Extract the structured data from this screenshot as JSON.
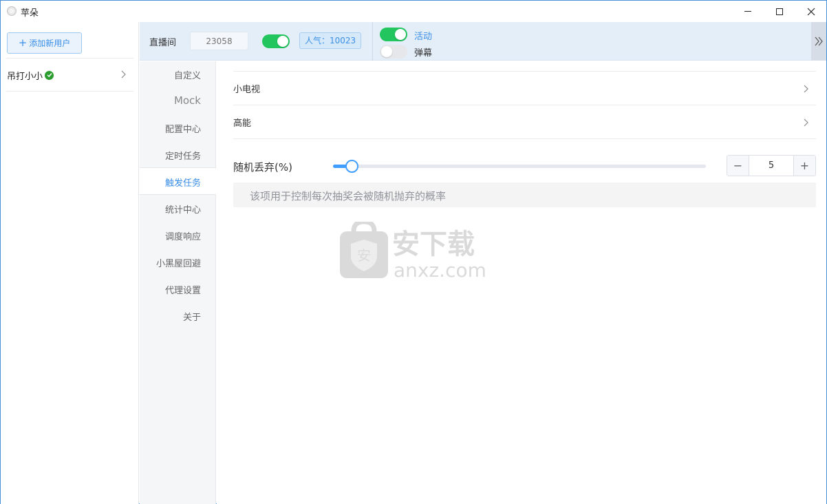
{
  "window": {
    "title": "苹朵",
    "controls": [
      "minimize",
      "maximize",
      "close"
    ]
  },
  "user_panel": {
    "add_user_label": "添加新用户",
    "users": [
      {
        "name": "吊打小小",
        "verified": true
      }
    ]
  },
  "topbar": {
    "room_label": "直播间",
    "room_input_placeholder": "23058",
    "room_toggle_on": true,
    "popularity": "人气：10023",
    "activity_label": "活动",
    "activity_on": true,
    "danmaku_label": "弹幕",
    "danmaku_on": false
  },
  "menu": {
    "items": [
      {
        "label": "自定义",
        "active": false
      },
      {
        "label": "Mock",
        "active": false
      },
      {
        "label": "配置中心",
        "active": false
      },
      {
        "label": "定时任务",
        "active": false
      },
      {
        "label": "触发任务",
        "active": true
      },
      {
        "label": "统计中心",
        "active": false
      },
      {
        "label": "调度响应",
        "active": false
      },
      {
        "label": "小黑屋回避",
        "active": false
      },
      {
        "label": "代理设置",
        "active": false
      },
      {
        "label": "关于",
        "active": false
      }
    ]
  },
  "content": {
    "rows": [
      {
        "label": "小电视"
      },
      {
        "label": "高能"
      }
    ],
    "slider": {
      "label": "随机丢弃(%)",
      "value": 5,
      "min": 0,
      "max": 100
    },
    "stepper": {
      "value": "5",
      "minus": "−",
      "plus": "+"
    },
    "hint": "该项用于控制每次抽奖会被随机抛弃的概率"
  },
  "watermark": {
    "text_cn": "安下载",
    "text_en": "anxz.com",
    "badge": "安"
  },
  "colors": {
    "accent": "#3a8ee6",
    "toggle_on": "#22c55e",
    "topbar_bg": "#e4eef9",
    "menu_bg": "#f5f6f8"
  }
}
